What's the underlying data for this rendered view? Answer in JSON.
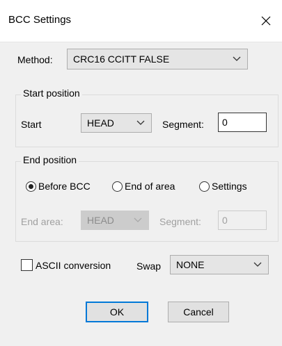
{
  "window": {
    "title": "BCC Settings",
    "close_icon": "close-icon"
  },
  "method": {
    "label": "Method:",
    "value": "CRC16 CCITT FALSE"
  },
  "start_position": {
    "title": "Start position",
    "start_label": "Start",
    "start_value": "HEAD",
    "segment_label": "Segment:",
    "segment_value": "0"
  },
  "end_position": {
    "title": "End position",
    "radios": [
      {
        "label": "Before BCC",
        "checked": true
      },
      {
        "label": "End of area",
        "checked": false
      },
      {
        "label": "Settings",
        "checked": false
      }
    ],
    "end_area_label": "End area:",
    "end_area_value": "HEAD",
    "segment_label": "Segment:",
    "segment_value": "0"
  },
  "ascii": {
    "label": "ASCII conversion",
    "checked": false
  },
  "swap": {
    "label": "Swap",
    "value": "NONE"
  },
  "buttons": {
    "ok": "OK",
    "cancel": "Cancel"
  }
}
